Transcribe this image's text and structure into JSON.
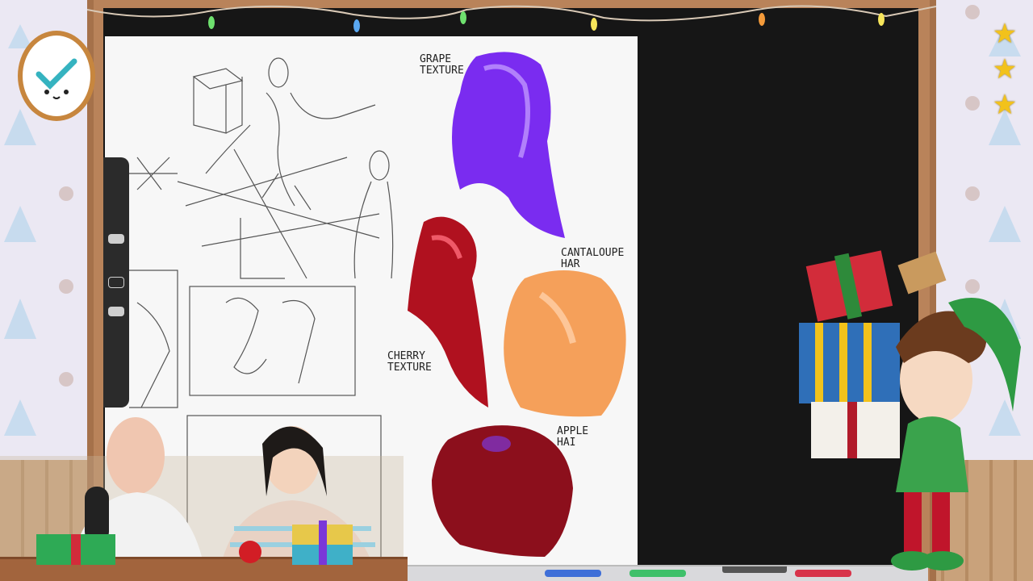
{
  "annotations": {
    "grape": "GRAPE\nTEXTURE",
    "cantaloupe": "CANTALOUPE\nHAR",
    "cherry": "CHERRY\nTEXTURE",
    "apple": "APPLE\nHAI"
  },
  "icons": {
    "clock": "clock-icon",
    "stars": [
      "star-icon",
      "star-icon",
      "star-icon"
    ],
    "checkmark": "checkmark-icon"
  },
  "colors": {
    "board": "#161616",
    "frame": "#b9835a",
    "grape_hair": "#7a2cf0",
    "cherry_hair": "#b0111f",
    "cantaloupe_hair": "#f5a05a",
    "apple_hair": "#8c0f1c",
    "star": "#f2c21b"
  }
}
